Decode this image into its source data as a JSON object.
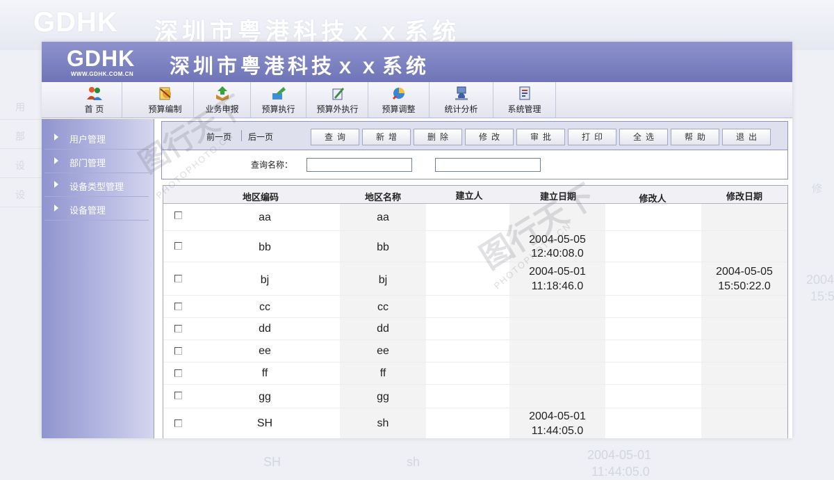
{
  "app": {
    "logo": "GDHK",
    "logo_sub": "WWW.GDHK.COM.CN",
    "title": "深圳市粤港科技ｘｘ系统"
  },
  "toolbar": {
    "items": [
      {
        "label": "首  页",
        "icon": "home-users-icon"
      },
      {
        "label": "预算编制",
        "icon": "budget-edit-icon"
      },
      {
        "label": "业务申报",
        "icon": "business-apply-icon"
      },
      {
        "label": "预算执行",
        "icon": "budget-execute-icon"
      },
      {
        "label": "预算外执行",
        "icon": "extra-budget-execute-icon"
      },
      {
        "label": "预算调整",
        "icon": "budget-adjust-icon"
      },
      {
        "label": "统计分析",
        "icon": "statistics-icon"
      },
      {
        "label": "系统管理",
        "icon": "system-manage-icon"
      }
    ]
  },
  "sidebar": {
    "items": [
      {
        "label": "用户管理"
      },
      {
        "label": "部门管理"
      },
      {
        "label": "设备类型管理"
      },
      {
        "label": "设备管理"
      }
    ]
  },
  "commands": {
    "prev_page": "前一页",
    "next_page": "后一页",
    "buttons": [
      "查询",
      "新增",
      "删除",
      "修改",
      "审批",
      "打印",
      "全选",
      "帮助",
      "退出"
    ]
  },
  "search": {
    "label": "查询名称：",
    "input1_value": "",
    "input2_value": ""
  },
  "table": {
    "columns": [
      "地区编码",
      "地区名称",
      "建立人",
      "建立日期",
      "修改人",
      "修改日期"
    ],
    "rows": [
      {
        "code": "aa",
        "name": "aa",
        "creator": "",
        "created_date": "",
        "created_time": "",
        "modifier": "",
        "modified_date": "",
        "modified_time": ""
      },
      {
        "code": "bb",
        "name": "bb",
        "creator": "",
        "created_date": "2004-05-05",
        "created_time": "12:40:08.0",
        "modifier": "",
        "modified_date": "",
        "modified_time": ""
      },
      {
        "code": "bj",
        "name": "bj",
        "creator": "",
        "created_date": "2004-05-01",
        "created_time": "11:18:46.0",
        "modifier": "",
        "modified_date": "2004-05-05",
        "modified_time": "15:50:22.0"
      },
      {
        "code": "cc",
        "name": "cc",
        "creator": "",
        "created_date": "",
        "created_time": "",
        "modifier": "",
        "modified_date": "",
        "modified_time": ""
      },
      {
        "code": "dd",
        "name": "dd",
        "creator": "",
        "created_date": "",
        "created_time": "",
        "modifier": "",
        "modified_date": "",
        "modified_time": ""
      },
      {
        "code": "ee",
        "name": "ee",
        "creator": "",
        "created_date": "",
        "created_time": "",
        "modifier": "",
        "modified_date": "",
        "modified_time": ""
      },
      {
        "code": "ff",
        "name": "ff",
        "creator": "",
        "created_date": "",
        "created_time": "",
        "modifier": "",
        "modified_date": "",
        "modified_time": ""
      },
      {
        "code": "gg",
        "name": "gg",
        "creator": "",
        "created_date": "",
        "created_time": "",
        "modifier": "",
        "modified_date": "",
        "modified_time": ""
      },
      {
        "code": "SH",
        "name": "sh",
        "creator": "",
        "created_date": "2004-05-01",
        "created_time": "11:44:05.0",
        "modifier": "",
        "modified_date": "",
        "modified_time": ""
      }
    ]
  },
  "background_echo": {
    "logo": "GDHK",
    "title": "深圳市粤港科技ｘｘ系统",
    "side_items": [
      "用",
      "部",
      "设",
      "设"
    ],
    "bottom_code": "SH",
    "bottom_name": "sh",
    "bottom_date": "2004-05-01",
    "bottom_time": "11:44:05.0",
    "right_header": "修",
    "right_date": "2004",
    "right_time": "15:5"
  },
  "watermark": {
    "text": "图行天下",
    "sub": "PHOTOPHOTO.CN"
  },
  "colors": {
    "header": "#7b80c0",
    "sidebar": "#9da1d6",
    "command_bar": "#dfe0ee",
    "input_border": "#6f7ab0"
  }
}
